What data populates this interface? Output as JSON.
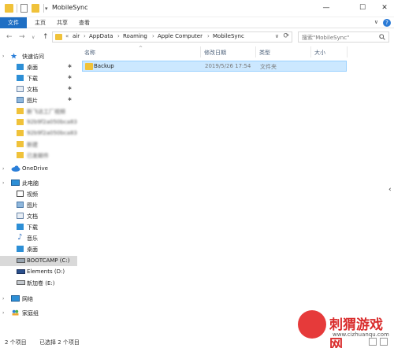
{
  "window": {
    "title": "MobileSync",
    "minimize": "—",
    "maximize": "☐",
    "close": "✕"
  },
  "ribbon": {
    "tabs": [
      "文件",
      "主页",
      "共享",
      "查看"
    ],
    "help": "?",
    "expand": "∨"
  },
  "nav": {
    "back": "←",
    "forward": "→",
    "history": "∨",
    "up": "↑",
    "breadcrumbs": [
      "«",
      "air",
      "AppData",
      "Roaming",
      "Apple Computer",
      "MobileSync"
    ],
    "dropdown": "∨",
    "refresh": "⟳",
    "search_placeholder": "搜索\"MobileSync\""
  },
  "sidebar": {
    "quick_access": "快速访问",
    "pinned": [
      {
        "label": "桌面",
        "icon": "desktop-icon"
      },
      {
        "label": "下载",
        "icon": "download-icon"
      },
      {
        "label": "文档",
        "icon": "document-icon"
      },
      {
        "label": "图片",
        "icon": "picture-icon"
      }
    ],
    "recent": [
      "新飞达工厂视频",
      "92b9f2a050bca83",
      "92b9f2a050bca83",
      "新建",
      "已发邮件"
    ],
    "onedrive": "OneDrive",
    "this_pc": "此电脑",
    "pc_items": [
      {
        "label": "视频",
        "icon": "video-icon"
      },
      {
        "label": "图片",
        "icon": "picture-icon"
      },
      {
        "label": "文档",
        "icon": "document-icon"
      },
      {
        "label": "下载",
        "icon": "download-icon"
      },
      {
        "label": "音乐",
        "icon": "music-icon"
      },
      {
        "label": "桌面",
        "icon": "desktop-icon"
      }
    ],
    "drives": [
      {
        "label": "BOOTCAMP (C:)",
        "icon": "drive-c-icon"
      },
      {
        "label": "Elements (D:)",
        "icon": "drive-d-icon"
      },
      {
        "label": "新加卷 (E:)",
        "icon": "drive-e-icon"
      }
    ],
    "network": "网络",
    "homegroup": "家庭组"
  },
  "columns": {
    "name": "名称",
    "modified": "修改日期",
    "type": "类型",
    "size": "大小",
    "sort_arrow": "^"
  },
  "files": [
    {
      "name": "Backup",
      "modified": "2019/5/26 17:54",
      "type": "文件夹",
      "size": ""
    }
  ],
  "status": {
    "count": "2 个项目",
    "selected": "已选择 2 个项目"
  },
  "watermark": {
    "text": "刺猬游戏网",
    "url": "www.cizhuanqu.com"
  },
  "colors": {
    "accent": "#1f6fc4",
    "folder": "#f0c23a",
    "selection": "#cce8ff",
    "selection_border": "#99d1ff"
  }
}
